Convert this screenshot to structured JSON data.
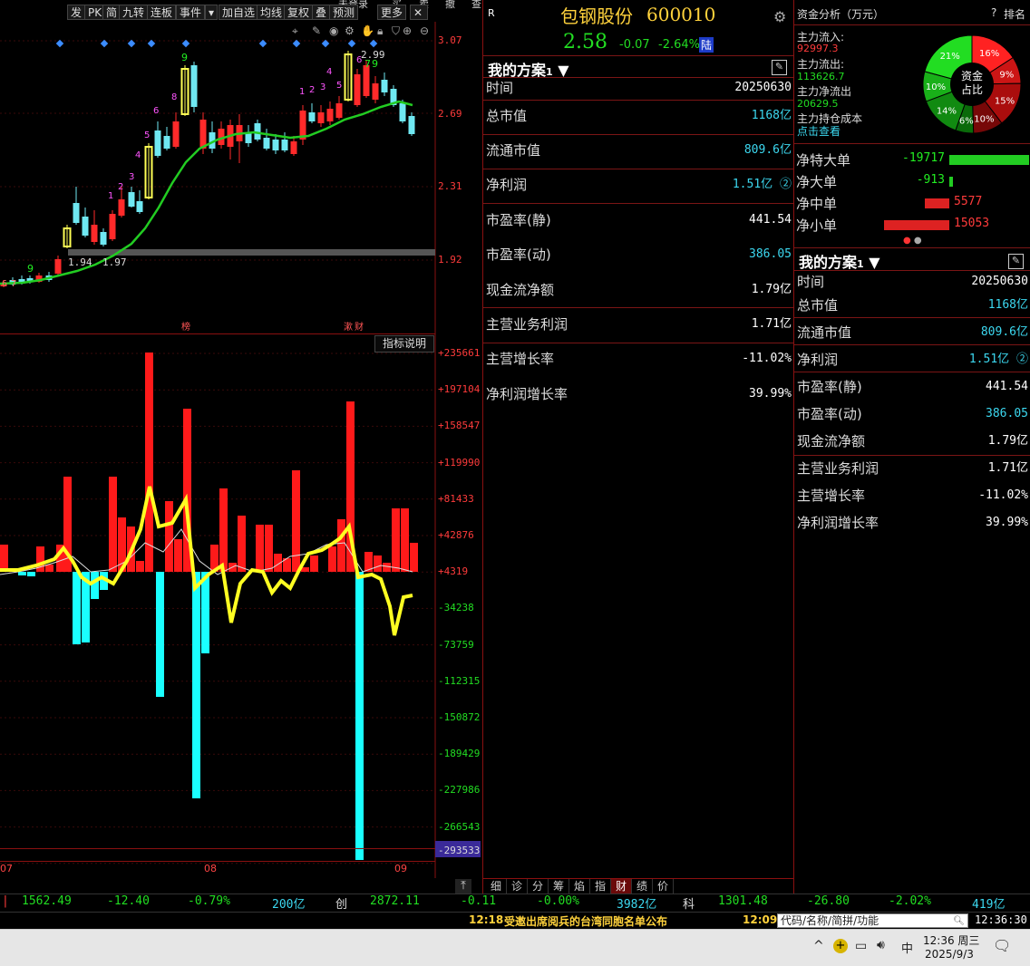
{
  "toolbar": {
    "buttons": [
      "发",
      "PK",
      "简",
      "九转",
      "连板",
      "事件",
      "加自选",
      "均线",
      "复权",
      "叠",
      "预测",
      "更多"
    ],
    "top_cut": [
      "未登录",
      "买",
      "卖",
      "撤",
      "查"
    ],
    "icons": [
      "crosshair-icon",
      "pencil-icon",
      "eye-icon",
      "settings-icon",
      "hand-icon",
      "lock-icon",
      "stamp-icon",
      "zoom-in-icon",
      "zoom-out-icon"
    ]
  },
  "stock": {
    "name": "包钢股份",
    "code": "600010",
    "price": "2.58",
    "change": "-0.07",
    "change_pct": "-2.64%",
    "market_tag": "陆",
    "r_label": "R"
  },
  "kchart": {
    "price_axis": [
      "3.07",
      "2.69",
      "2.31",
      "1.92"
    ],
    "high_label": "2.99",
    "low_label": "1.94",
    "low_label2": "1.97",
    "marker_bang": "榜",
    "marker_caibao": "财",
    "marker_caibao_prefix": "漱",
    "seq_labels": [
      "6",
      "7",
      "9",
      "1",
      "2",
      "3",
      "4",
      "5",
      "6",
      "8",
      "9",
      "1",
      "2",
      "3",
      "4",
      "5",
      "6",
      "7",
      "8",
      "9"
    ]
  },
  "indicator": {
    "button": "指标说明",
    "axis": [
      "+235661",
      "+197104",
      "+158547",
      "+119990",
      "+81433",
      "+42876",
      "+4319",
      "-34238",
      "-73759",
      "-112315",
      "-150872",
      "-189429",
      "-227986",
      "-266543",
      "-293533"
    ]
  },
  "dates": {
    "d1": "07",
    "d2": "08",
    "d3": "09"
  },
  "scheme_mid": {
    "title": "我的方案",
    "title_num": "1",
    "rows": [
      {
        "label": "时间",
        "value": "20250630",
        "cyan": false
      },
      {
        "label": "总市值",
        "value": "1168亿",
        "cyan": true
      },
      {
        "label": "流通市值",
        "value": "809.6亿",
        "cyan": true
      },
      {
        "label": "净利润",
        "value": "1.51亿 ②",
        "cyan": true
      },
      {
        "label": "市盈率(静)",
        "value": "441.54",
        "cyan": false
      },
      {
        "label": "市盈率(动)",
        "value": "386.05",
        "cyan": true
      },
      {
        "label": "现金流净额",
        "value": "1.79亿",
        "cyan": false
      },
      {
        "label": "主营业务利润",
        "value": "1.71亿",
        "cyan": false
      },
      {
        "label": "主营增长率",
        "value": "-11.02%",
        "cyan": false
      },
      {
        "label": "净利润增长率",
        "value": "39.99%",
        "cyan": false
      }
    ]
  },
  "bottom_tabs": [
    "细",
    "诊",
    "分",
    "筹",
    "焰",
    "指",
    "财",
    "绩",
    "价"
  ],
  "fund": {
    "title": "资金分析（万元）",
    "help": "?",
    "rank": "排名",
    "inflow_label": "主力流入:",
    "inflow": "92997.3",
    "outflow_label": "主力流出:",
    "outflow": "113626.7",
    "net_label": "主力净流出",
    "net": "20629.5",
    "cost_label": "主力持仓成本",
    "click": "点击查看",
    "pie_center": "资金\n占比",
    "pie_center_1": "资金",
    "pie_center_2": "占比",
    "pie_slices": [
      {
        "label": "16%",
        "value": 16,
        "color": "#ff2222"
      },
      {
        "label": "9%",
        "value": 9,
        "color": "#cc1515"
      },
      {
        "label": "15%",
        "value": 15,
        "color": "#aa0d0d"
      },
      {
        "label": "10%",
        "value": 10,
        "color": "#770808"
      },
      {
        "label": "6%",
        "value": 6,
        "color": "#0a6a0a"
      },
      {
        "label": "14%",
        "value": 14,
        "color": "#118a11"
      },
      {
        "label": "10%",
        "value": 10,
        "color": "#19b019"
      },
      {
        "label": "21%",
        "value": 21,
        "color": "#22dd22"
      }
    ],
    "orders": [
      {
        "label": "净特大单",
        "value": "-19717",
        "color": "#22cc22",
        "frac": 1.0,
        "dir": "green"
      },
      {
        "label": "净大单",
        "value": "-913",
        "color": "#22cc22",
        "frac": 0.05,
        "dir": "green"
      },
      {
        "label": "净中单",
        "value": "5577",
        "color": "#dd2222",
        "frac": 0.37,
        "dir": "red"
      },
      {
        "label": "净小单",
        "value": "15053",
        "color": "#dd2222",
        "frac": 1.0,
        "dir": "red"
      }
    ]
  },
  "scheme_right": {
    "title": "我的方案",
    "title_num": "1",
    "rows": [
      {
        "label": "时间",
        "value": "20250630",
        "cyan": false
      },
      {
        "label": "总市值",
        "value": "1168亿",
        "cyan": true
      },
      {
        "label": "流通市值",
        "value": "809.6亿",
        "cyan": true
      },
      {
        "label": "净利润",
        "value": "1.51亿 ②",
        "cyan": true
      },
      {
        "label": "市盈率(静)",
        "value": "441.54",
        "cyan": false
      },
      {
        "label": "市盈率(动)",
        "value": "386.05",
        "cyan": true
      },
      {
        "label": "现金流净额",
        "value": "1.79亿",
        "cyan": false
      },
      {
        "label": "主营业务利润",
        "value": "1.71亿",
        "cyan": false
      },
      {
        "label": "主营增长率",
        "value": "-11.02%",
        "cyan": false
      },
      {
        "label": "净利润增长率",
        "value": "39.99%",
        "cyan": false
      }
    ]
  },
  "status": {
    "idx1": "1562.49",
    "idx1_chg": "-12.40",
    "idx1_pct": "-0.79%",
    "idx1_amt": "200亿",
    "chuang": "创",
    "idx2": "2872.11",
    "idx2_chg": "-0.11",
    "idx2_pct": "-0.00%",
    "idx2_amt": "3982亿",
    "ke": "科",
    "idx3": "1301.48",
    "idx3_chg": "-26.80",
    "idx3_pct": "-2.02%",
    "idx3_amt": "419亿"
  },
  "news": {
    "time1": "12:18",
    "headline": "受邀出席阅兵的台湾同胞名单公布",
    "time2": "12:09",
    "search_placeholder": "代码/名称/简拼/功能",
    "clock": "12:36:30"
  },
  "taskbar": {
    "time": "12:36 周三",
    "date": "2025/9/3",
    "ime": "中"
  },
  "colors": {
    "red": "#ff2222",
    "green": "#22dd22",
    "cyan": "#00ffff",
    "yellow": "#ffff33",
    "bg": "#000000"
  }
}
